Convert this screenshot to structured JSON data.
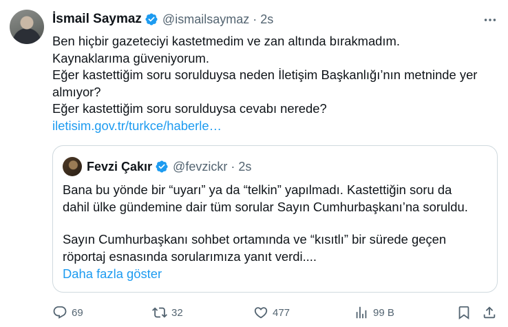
{
  "author": {
    "name": "İsmail Saymaz",
    "handle": "@ismailsaymaz",
    "separator": "·",
    "time": "2s"
  },
  "body": {
    "lines": [
      "Ben hiçbir gazeteciyi kastetmedim ve zan altında bırakmadım.",
      "Kaynaklarıma güveniyorum.",
      "Eğer kastettiğim soru sorulduysa neden İletişim Başkanlığı’nın metninde yer",
      "almıyor?",
      "Eğer kastettiğim soru sorulduysa cevabı nerede?"
    ],
    "link": "iletisim.gov.tr/turkce/haberle…"
  },
  "quote": {
    "name": "Fevzi Çakır",
    "handle": "@fevzickr",
    "separator": "·",
    "time": "2s",
    "lines": [
      "Bana bu yönde bir “uyarı” ya da “telkin” yapılmadı. Kastettiğin soru da",
      "dahil ülke gündemine dair tüm sorular Sayın Cumhurbaşkanı’na soruldu.",
      "Sayın Cumhurbaşkanı sohbet ortamında ve “kısıtlı” bir sürede geçen",
      "röportaj esnasında sorularımıza yanıt verdi...."
    ],
    "show_more": "Daha fazla göster"
  },
  "actions": {
    "replies": "69",
    "reposts": "32",
    "likes": "477",
    "views": "99 B"
  },
  "icons": {
    "verified": "verified-badge-icon",
    "more": "more-options-icon",
    "reply": "reply-icon",
    "repost": "repost-icon",
    "like": "heart-icon",
    "views": "analytics-icon",
    "bookmark": "bookmark-icon",
    "share": "share-icon"
  },
  "colors": {
    "accent": "#1d9bf0",
    "text": "#0f1419",
    "secondary": "#536471",
    "border": "#cfd9de"
  }
}
